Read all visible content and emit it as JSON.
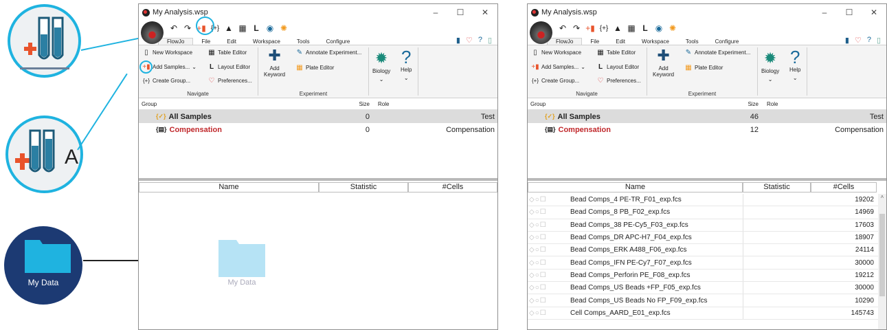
{
  "callouts": {
    "circle3_label": "My Data",
    "circle2_letter": "A"
  },
  "left_window": {
    "title": "My Analysis.wsp",
    "menu": [
      "FlowJo",
      "File",
      "Edit",
      "Workspace",
      "Tools",
      "Configure"
    ],
    "ribbon": {
      "new_workspace": "New Workspace",
      "add_samples": "Add Samples...",
      "create_group": "Create Group...",
      "table_editor": "Table Editor",
      "layout_editor": "Layout Editor",
      "preferences": "Preferences...",
      "add_keyword": "Add\nKeyword",
      "annotate_experiment": "Annotate Experiment...",
      "plate_editor": "Plate Editor",
      "biology": "Biology",
      "help": "Help",
      "group_navigate": "Navigate",
      "group_experiment": "Experiment"
    },
    "groups_header": {
      "group": "Group",
      "size": "Size",
      "role": "Role"
    },
    "groups": [
      {
        "name": "All Samples",
        "size": "0",
        "role": "Test"
      },
      {
        "name": "Compensation",
        "size": "0",
        "role": "Compensation"
      }
    ],
    "table_header": {
      "name": "Name",
      "statistic": "Statistic",
      "cells": "#Cells"
    },
    "folder_label": "My Data"
  },
  "right_window": {
    "title": "My Analysis.wsp",
    "menu": [
      "FlowJo",
      "File",
      "Edit",
      "Workspace",
      "Tools",
      "Configure"
    ],
    "ribbon": {
      "new_workspace": "New Workspace",
      "add_samples": "Add Samples...",
      "create_group": "Create Group...",
      "table_editor": "Table Editor",
      "layout_editor": "Layout Editor",
      "preferences": "Preferences...",
      "add_keyword": "Add\nKeyword",
      "annotate_experiment": "Annotate Experiment...",
      "plate_editor": "Plate Editor",
      "biology": "Biology",
      "help": "Help",
      "group_navigate": "Navigate",
      "group_experiment": "Experiment"
    },
    "groups_header": {
      "group": "Group",
      "size": "Size",
      "role": "Role"
    },
    "groups": [
      {
        "name": "All Samples",
        "size": "46",
        "role": "Test"
      },
      {
        "name": "Compensation",
        "size": "12",
        "role": "Compensation"
      }
    ],
    "table_header": {
      "name": "Name",
      "statistic": "Statistic",
      "cells": "#Cells"
    },
    "rows": [
      {
        "name": "Bead Comps_4 PE-TR_F01_exp.fcs",
        "cells": "19202"
      },
      {
        "name": "Bead Comps_8 PB_F02_exp.fcs",
        "cells": "14969"
      },
      {
        "name": "Bead Comps_38 PE-Cy5_F03_exp.fcs",
        "cells": "17603"
      },
      {
        "name": "Bead Comps_DR APC-H7_F04_exp.fcs",
        "cells": "18907"
      },
      {
        "name": "Bead Comps_ERK A488_F06_exp.fcs",
        "cells": "24114"
      },
      {
        "name": "Bead Comps_IFN PE-Cy7_F07_exp.fcs",
        "cells": "30000"
      },
      {
        "name": "Bead Comps_Perforin PE_F08_exp.fcs",
        "cells": "19212"
      },
      {
        "name": "Bead Comps_US Beads +FP_F05_exp.fcs",
        "cells": "30000"
      },
      {
        "name": "Bead Comps_US Beads No FP_F09_exp.fcs",
        "cells": "10290"
      },
      {
        "name": "Cell Comps_AARD_E01_exp.fcs",
        "cells": "145743"
      }
    ]
  },
  "colors": {
    "accent": "#1fb3e0",
    "navy": "#1c3a73",
    "red": "#c0282b"
  }
}
